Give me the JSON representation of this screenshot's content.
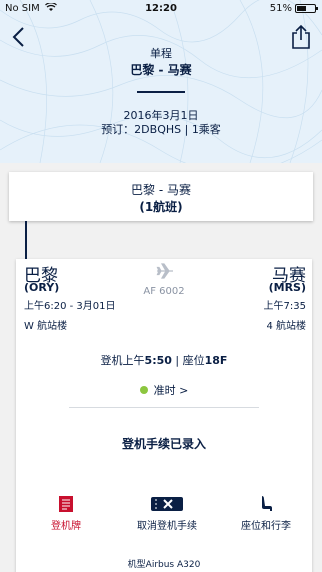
{
  "status_bar": {
    "carrier": "No SIM",
    "time": "12:20",
    "battery": "51%"
  },
  "header": {
    "trip_type": "单程",
    "route": "巴黎 - 马赛",
    "date": "2016年3月1日",
    "booking": "预订：2DBQHS | 1乘客"
  },
  "summary": {
    "route": "巴黎 - 马赛",
    "flight_count": "(1航班)"
  },
  "flight": {
    "departure": {
      "city": "巴黎",
      "code": "(ORY)",
      "time": "上午6:20 - 3月01日",
      "terminal": "W 航站楼"
    },
    "arrival": {
      "city": "马赛",
      "code": "(MRS)",
      "time": "上午7:35",
      "terminal": "4 航站楼"
    },
    "number": "AF 6002",
    "boarding_prefix": "登机上午",
    "boarding_time": "5:50",
    "seat_prefix": " | 座位",
    "seat": "18F",
    "status": "准时 >",
    "status_color": "#8cc63f",
    "checkin_message": "登机手续已录入",
    "actions": {
      "boarding_pass": "登机牌",
      "cancel_checkin": "取消登机手续",
      "seat_baggage": "座位和行李"
    },
    "aircraft": "机型Airbus A320"
  },
  "colors": {
    "navy": "#0a1f44",
    "hero_bg": "#e6f1fa",
    "accent_red": "#c8102e"
  }
}
